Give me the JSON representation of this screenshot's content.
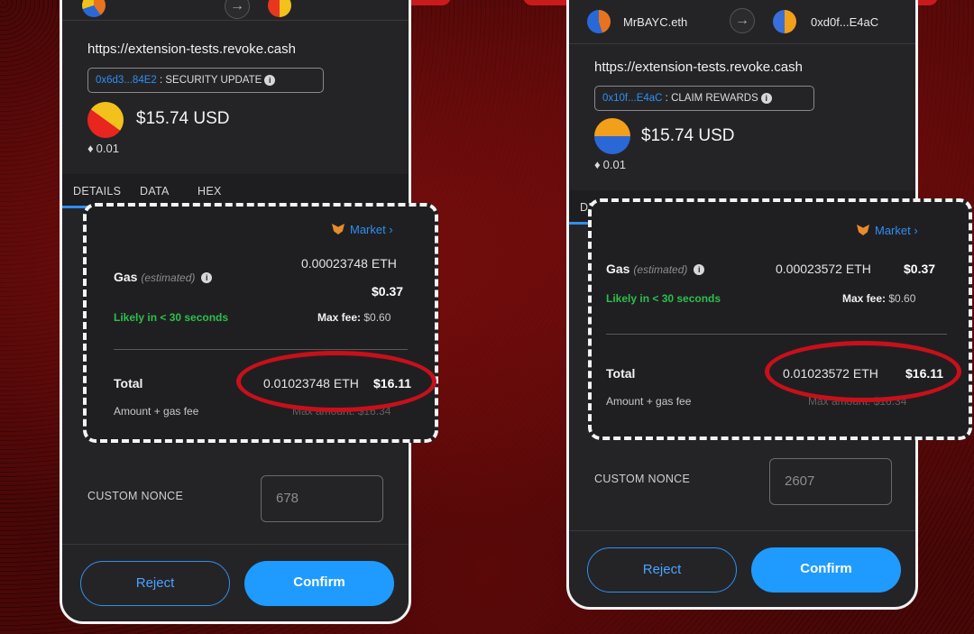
{
  "left": {
    "url": "https://extension-tests.revoke.cash",
    "badge": {
      "address": "0x6d3...84E2",
      "separator": " : ",
      "action": "SECURITY UPDATE",
      "info": "i"
    },
    "amount_usd": "$15.74 USD",
    "amount_eth": "0.01",
    "tabs": [
      "DETAILS",
      "DATA",
      "HEX"
    ],
    "market": "Market",
    "gas_label": "Gas",
    "gas_estimated": "(estimated)",
    "gas_eth": "0.00023748 ETH",
    "gas_usd": "$0.37",
    "likely": "Likely in < 30 seconds",
    "max_fee_label": "Max fee:",
    "max_fee_value": "$0.60",
    "total_label": "Total",
    "total_eth": "0.01023748 ETH",
    "total_usd": "$16.11",
    "amount_gas": "Amount + gas fee",
    "max_amount_faded": "Max amount: $16.34",
    "nonce_label": "CUSTOM NONCE",
    "nonce_value": "678",
    "reject": "Reject",
    "confirm": "Confirm"
  },
  "right": {
    "from_account": "MrBAYC.eth",
    "to_account": "0xd0f...E4aC",
    "arrow": "→",
    "url": "https://extension-tests.revoke.cash",
    "badge": {
      "address": "0x10f...E4aC",
      "separator": " : ",
      "action": "CLAIM REWARDS",
      "info": "i"
    },
    "amount_usd": "$15.74 USD",
    "amount_eth": "0.01",
    "tab_partial": "DE",
    "market": "Market",
    "gas_label": "Gas",
    "gas_estimated": "(estimated)",
    "gas_eth": "0.00023572 ETH",
    "gas_usd": "$0.37",
    "likely": "Likely in < 30 seconds",
    "max_fee_label": "Max fee:",
    "max_fee_value": "$0.60",
    "total_label": "Total",
    "total_eth": "0.01023572 ETH",
    "total_usd": "$16.11",
    "amount_gas": "Amount + gas fee",
    "max_amount_faded": "Max amount: $16.34",
    "nonce_label": "CUSTOM NONCE",
    "nonce_value": "2607",
    "reject": "Reject",
    "confirm": "Confirm"
  },
  "colors": {
    "accent_blue": "#1f9bff",
    "link_blue": "#2f8ff0",
    "green": "#2dbf4a",
    "highlight_red": "#c8101a",
    "background_red": "#4a0707"
  },
  "icons": [
    "arrow-right-icon",
    "ethereum-icon",
    "info-icon",
    "metamask-fox-icon",
    "chevron-right-icon"
  ]
}
